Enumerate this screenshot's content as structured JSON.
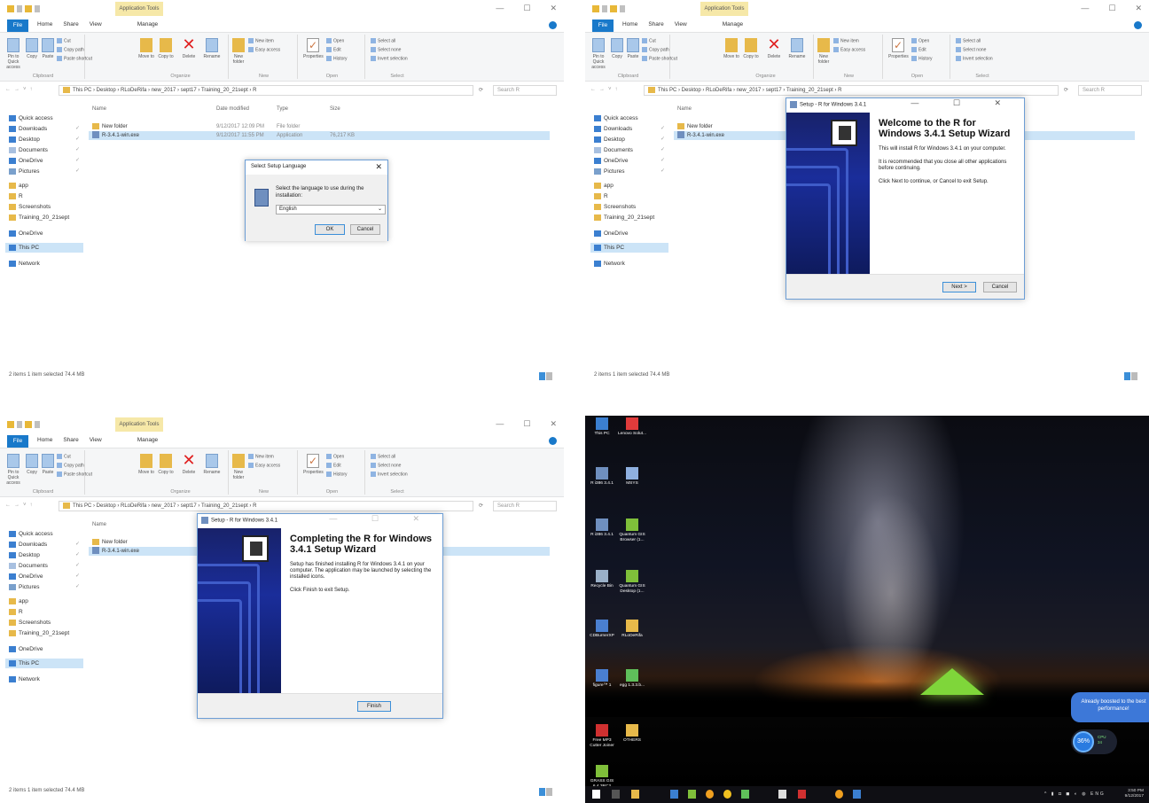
{
  "explorer": {
    "app_tools": "Application Tools",
    "tabs": [
      "Home",
      "Share",
      "View",
      "Manage"
    ],
    "file_tab": "File",
    "ribbon": {
      "pin": "Pin to Quick access",
      "copy": "Copy",
      "paste": "Paste",
      "cut": "Cut",
      "copy_path": "Copy path",
      "paste_shortcut": "Paste shortcut",
      "clipboard": "Clipboard",
      "move_to": "Move to",
      "copy_to": "Copy to",
      "delete": "Delete",
      "rename": "Rename",
      "organize": "Organize",
      "new_folder": "New folder",
      "new_item": "New item",
      "easy_access": "Easy access",
      "new": "New",
      "properties": "Properties",
      "open": "Open",
      "edit": "Edit",
      "history": "History",
      "open_group": "Open",
      "select_all": "Select all",
      "select_none": "Select none",
      "invert_selection": "Invert selection",
      "select": "Select"
    },
    "address": {
      "path": "This PC  ›  Desktop  ›  RLoDeRifa  ›  new_2017  ›  sept17  ›  Training_20_21sept  ›  R",
      "search_placeholder": "Search R"
    },
    "nav": {
      "quick_access": "Quick access",
      "downloads": "Downloads",
      "desktop": "Desktop",
      "documents": "Documents",
      "onedrive_pinned": "OneDrive",
      "pictures": "Pictures",
      "app": "app",
      "r": "R",
      "screenshots": "Screenshots",
      "training": "Training_20_21sept",
      "onedrive": "OneDrive",
      "this_pc": "This PC",
      "network": "Network",
      "pin_glyph": "✓"
    },
    "columns": {
      "name": "Name",
      "date": "Date modified",
      "type": "Type",
      "size": "Size"
    },
    "files": [
      {
        "name": "New folder",
        "date": "9/12/2017 12:09 PM",
        "type": "File folder",
        "size": ""
      },
      {
        "name": "R-3.4.1-win.exe",
        "date": "9/12/2017 11:55 PM",
        "type": "Application",
        "size": "76,217 KB"
      }
    ],
    "status": "2 items    1 item selected  74.4 MB"
  },
  "lang_dialog": {
    "title": "Select Setup Language",
    "close": "✕",
    "prompt": "Select the language to use during the installation:",
    "language": "English",
    "arrow": "⌄",
    "ok": "OK",
    "cancel": "Cancel"
  },
  "welcome_wizard": {
    "title": "Setup - R for Windows 3.4.1",
    "controls": "— ☐ ✕",
    "heading": "Welcome to the R for Windows 3.4.1 Setup Wizard",
    "p1": "This will install R for Windows 3.4.1 on your computer.",
    "p2": "It is recommended that you close all other applications before continuing.",
    "p3": "Click Next to continue, or Cancel to exit Setup.",
    "next": "Next >",
    "cancel": "Cancel"
  },
  "complete_wizard": {
    "title": "Setup - R for Windows 3.4.1",
    "controls": "— ☐ ✕",
    "heading": "Completing the R for Windows 3.4.1 Setup Wizard",
    "p1": "Setup has finished installing R for Windows 3.4.1 on your computer. The application may be launched by selecting the installed icons.",
    "p2": "Click Finish to exit Setup.",
    "finish": "Finish"
  },
  "desktop": {
    "icons": [
      {
        "label": "This PC",
        "color": "#3b7fd0"
      },
      {
        "label": "Lenovo Solut...",
        "color": "#e03b3b"
      },
      {
        "label": "R i386 3.4.1",
        "color": "#6f8fbf"
      },
      {
        "label": "MSYS",
        "color": "#8fb0e0"
      },
      {
        "label": "R i386 3.4.1",
        "color": "#6f8fbf"
      },
      {
        "label": "Quantum GIS Browser (1...",
        "color": "#7fbf3a"
      },
      {
        "label": "Recycle Bin",
        "color": "#9ab0c8"
      },
      {
        "label": "Quantum GIS Desktop (1...",
        "color": "#7fbf3a"
      },
      {
        "label": "CDBurnerXP",
        "color": "#4a7fd0"
      },
      {
        "label": "RLoDeRifa",
        "color": "#e7b94a"
      },
      {
        "label": "figure™ 1",
        "color": "#4a7fd0"
      },
      {
        "label": "egg 1.3.3.b...",
        "color": "#5fbf5a"
      },
      {
        "label": "Free MP3 Cutter Joiner",
        "color": "#d03030"
      },
      {
        "label": "OTHERS",
        "color": "#e7b94a"
      },
      {
        "label": "GRASS GIS 6.4.3RC2",
        "color": "#7fbf3a"
      }
    ],
    "toast": "Already boosted to the best performance!",
    "boost_pct": "36%",
    "cpu_label": "CPU",
    "cpu_value": "34",
    "taskbar_time": "3:50 PM",
    "taskbar_date": "9/12/2017",
    "tray": "^ ▮ ◘ ◼ ◐ ◍ ENG"
  }
}
